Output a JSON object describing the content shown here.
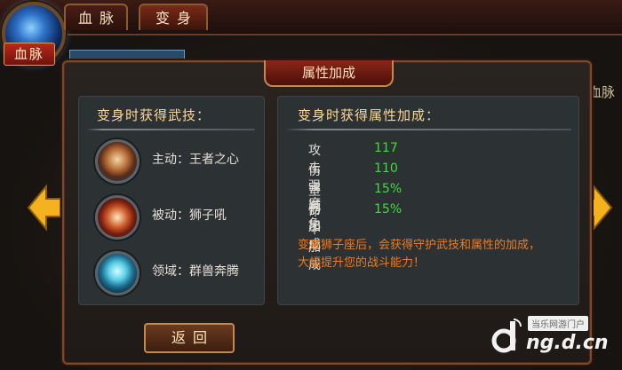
{
  "top": {
    "orb_label": "血脉",
    "tabs": [
      {
        "label": "血脉",
        "active": false
      },
      {
        "label": "变身",
        "active": true
      }
    ],
    "side_sub": "血脉"
  },
  "dialog": {
    "title": "属性加成",
    "left_panel": {
      "heading": "变身时获得武技：",
      "skills": [
        {
          "icon": "lion-icon",
          "text": "主动：王者之心"
        },
        {
          "icon": "lion-roar-icon",
          "text": "被动：狮子吼"
        },
        {
          "icon": "beast-spirit-icon",
          "text": "领域：群兽奔腾"
        }
      ]
    },
    "right_panel": {
      "heading": "变身时获得属性加成：",
      "attributes": [
        {
          "name": "攻击强度",
          "value": "117"
        },
        {
          "name": "伤害减免",
          "value": "110"
        },
        {
          "name": "坚韧加成",
          "value": "15%"
        },
        {
          "name": "命中加成",
          "value": "15%"
        }
      ],
      "description": [
        "变身狮子座后，会获得守护武技和属性的加成，",
        "大幅提升您的战斗能力！"
      ]
    },
    "back_label": "返回"
  },
  "watermark": {
    "tag": "当乐网游门户",
    "url": "ng.d.cn"
  },
  "colors": {
    "value_green": "#3fdc3a",
    "description_orange": "#f07a1e",
    "heading_gold": "#ffd894"
  }
}
